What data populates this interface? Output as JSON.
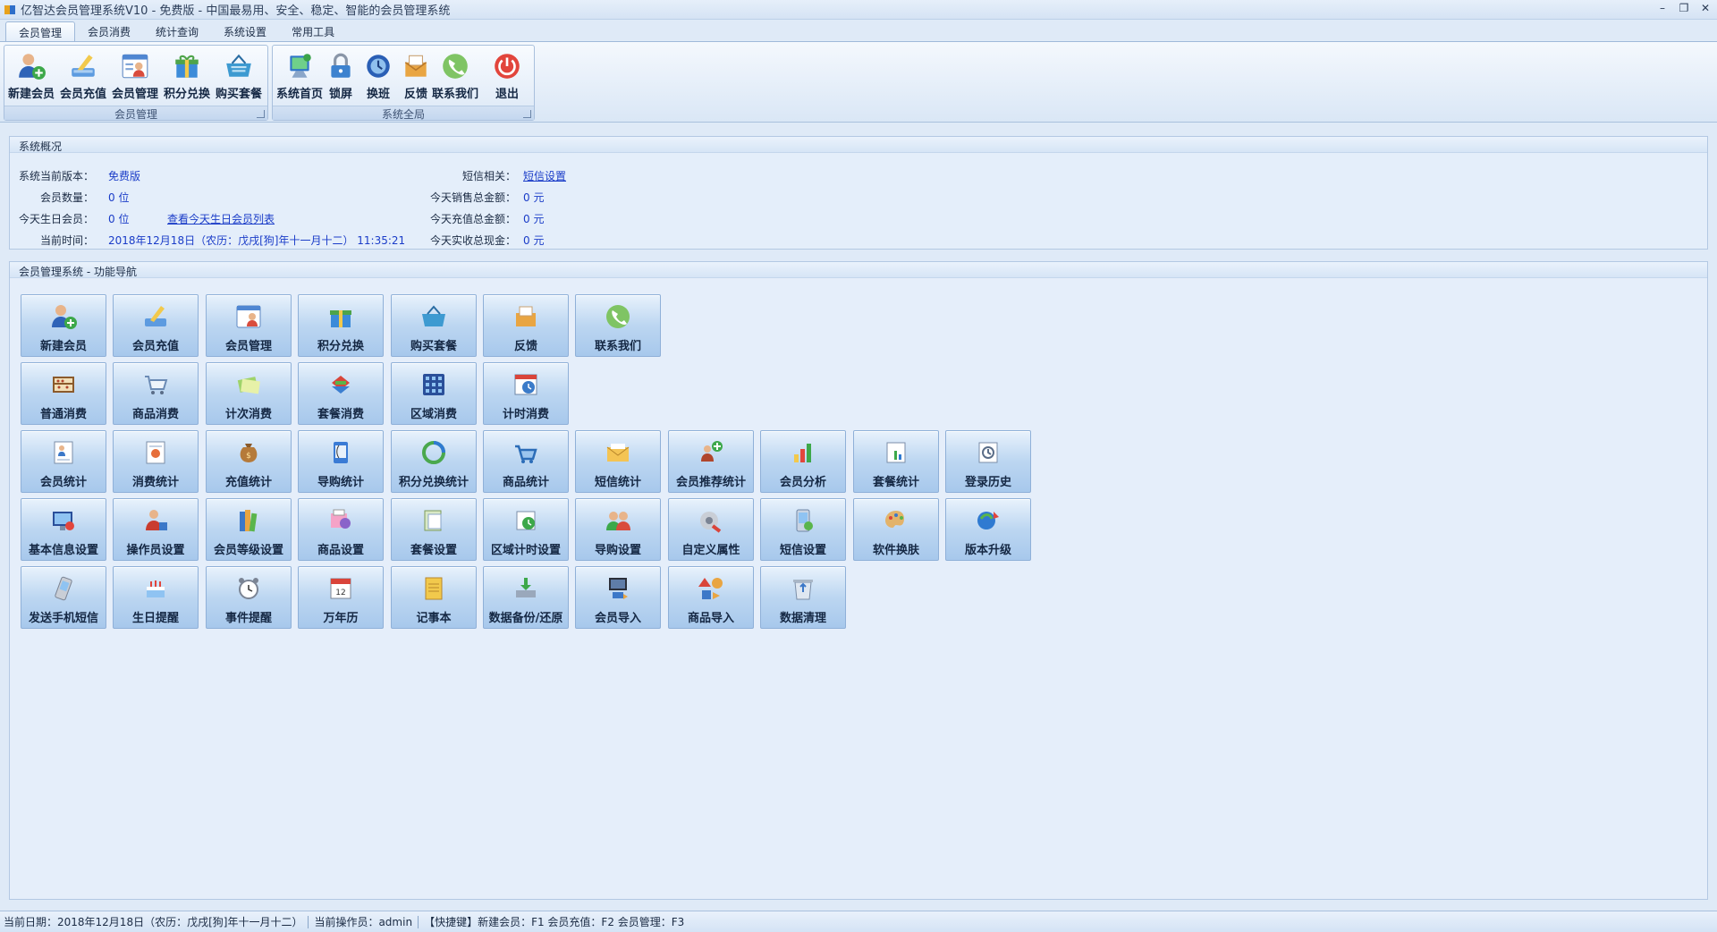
{
  "window": {
    "title": "亿智达会员管理系统V10 - 免费版 - 中国最易用、安全、稳定、智能的会员管理系统",
    "controls": [
      "–",
      "❐",
      "✕"
    ]
  },
  "tabs": [
    {
      "label": "会员管理",
      "active": true
    },
    {
      "label": "会员消费",
      "active": false
    },
    {
      "label": "统计查询",
      "active": false
    },
    {
      "label": "系统设置",
      "active": false
    },
    {
      "label": "常用工具",
      "active": false
    }
  ],
  "ribbon": {
    "group1": {
      "label": "会员管理",
      "buttons": [
        {
          "label": "新建会员",
          "icon": "new-member-icon"
        },
        {
          "label": "会员充值",
          "icon": "recharge-icon"
        },
        {
          "label": "会员管理",
          "icon": "member-manage-icon"
        },
        {
          "label": "积分兑换",
          "icon": "points-exchange-icon"
        },
        {
          "label": "购买套餐",
          "icon": "buy-package-icon"
        }
      ]
    },
    "group2": {
      "label": "系统全局",
      "buttons": [
        {
          "label": "系统首页",
          "icon": "home-icon"
        },
        {
          "label": "锁屏",
          "icon": "lock-icon"
        },
        {
          "label": "换班",
          "icon": "shift-icon"
        },
        {
          "label": "反馈",
          "icon": "feedback-icon"
        },
        {
          "label": "联系我们",
          "icon": "phone-icon"
        },
        {
          "label": "退出",
          "icon": "exit-icon"
        }
      ]
    }
  },
  "overview": {
    "title": "系统概况",
    "version_label": "系统当前版本：",
    "version_value": "免费版",
    "member_count_label": "会员数量：",
    "member_count_value": "0 位",
    "birthday_label": "今天生日会员：",
    "birthday_value": "0 位",
    "birthday_link": "查看今天生日会员列表",
    "time_label": "当前时间：",
    "time_value": "2018年12月18日（农历：戊戌[狗]年十一月十二）  11:35:21",
    "sms_label": "短信相关：",
    "sms_link": "短信设置",
    "sales_label": "今天销售总金额：",
    "sales_value": "0 元",
    "recharge_label": "今天充值总金额：",
    "recharge_value": "0 元",
    "cash_label": "今天实收总现金：",
    "cash_value": "0 元"
  },
  "nav": {
    "title": "会员管理系统 - 功能导航",
    "rows": [
      [
        {
          "label": "新建会员",
          "icon": "new-member-icon"
        },
        {
          "label": "会员充值",
          "icon": "recharge-icon"
        },
        {
          "label": "会员管理",
          "icon": "member-manage-icon"
        },
        {
          "label": "积分兑换",
          "icon": "points-exchange-icon"
        },
        {
          "label": "购买套餐",
          "icon": "buy-package-icon"
        },
        {
          "label": "反馈",
          "icon": "feedback-icon"
        },
        {
          "label": "联系我们",
          "icon": "phone-icon"
        }
      ],
      [
        {
          "label": "普通消费",
          "icon": "abacus-icon"
        },
        {
          "label": "商品消费",
          "icon": "cart-icon"
        },
        {
          "label": "计次消费",
          "icon": "count-consume-icon"
        },
        {
          "label": "套餐消费",
          "icon": "package-consume-icon"
        },
        {
          "label": "区域消费",
          "icon": "area-grid-icon"
        },
        {
          "label": "计时消费",
          "icon": "clock-calendar-icon"
        }
      ],
      [
        {
          "label": "会员统计",
          "icon": "member-stats-icon"
        },
        {
          "label": "消费统计",
          "icon": "consume-stats-icon"
        },
        {
          "label": "充值统计",
          "icon": "money-bag-icon"
        },
        {
          "label": "导购统计",
          "icon": "guide-stats-icon"
        },
        {
          "label": "积分兑换统计",
          "icon": "refresh-circle-icon"
        },
        {
          "label": "商品统计",
          "icon": "basket-icon"
        },
        {
          "label": "短信统计",
          "icon": "envelope-icon"
        },
        {
          "label": "会员推荐统计",
          "icon": "referral-icon"
        },
        {
          "label": "会员分析",
          "icon": "bar-chart-icon"
        },
        {
          "label": "套餐统计",
          "icon": "package-stats-icon"
        },
        {
          "label": "登录历史",
          "icon": "login-history-icon"
        }
      ],
      [
        {
          "label": "基本信息设置",
          "icon": "monitor-settings-icon"
        },
        {
          "label": "操作员设置",
          "icon": "operator-icon"
        },
        {
          "label": "会员等级设置",
          "icon": "books-icon"
        },
        {
          "label": "商品设置",
          "icon": "product-settings-icon"
        },
        {
          "label": "套餐设置",
          "icon": "package-settings-icon"
        },
        {
          "label": "区域计时设置",
          "icon": "area-timer-icon"
        },
        {
          "label": "导购设置",
          "icon": "guide-settings-icon"
        },
        {
          "label": "自定义属性",
          "icon": "custom-attr-icon"
        },
        {
          "label": "短信设置",
          "icon": "sms-settings-icon"
        },
        {
          "label": "软件换肤",
          "icon": "palette-icon"
        },
        {
          "label": "版本升级",
          "icon": "upgrade-icon"
        }
      ],
      [
        {
          "label": "发送手机短信",
          "icon": "mobile-sms-icon"
        },
        {
          "label": "生日提醒",
          "icon": "cake-icon"
        },
        {
          "label": "事件提醒",
          "icon": "alarm-icon"
        },
        {
          "label": "万年历",
          "icon": "calendar-icon"
        },
        {
          "label": "记事本",
          "icon": "notepad-icon"
        },
        {
          "label": "数据备份/还原",
          "icon": "backup-icon"
        },
        {
          "label": "会员导入",
          "icon": "member-import-icon"
        },
        {
          "label": "商品导入",
          "icon": "product-import-icon"
        },
        {
          "label": "数据清理",
          "icon": "recycle-bin-icon"
        }
      ]
    ]
  },
  "statusbar": {
    "date": "当前日期：2018年12月18日（农历：戊戌[狗]年十一月十二）",
    "operator": "当前操作员：admin",
    "shortcuts": "【快捷键】新建会员：F1  会员充值：F2  会员管理：F3"
  }
}
